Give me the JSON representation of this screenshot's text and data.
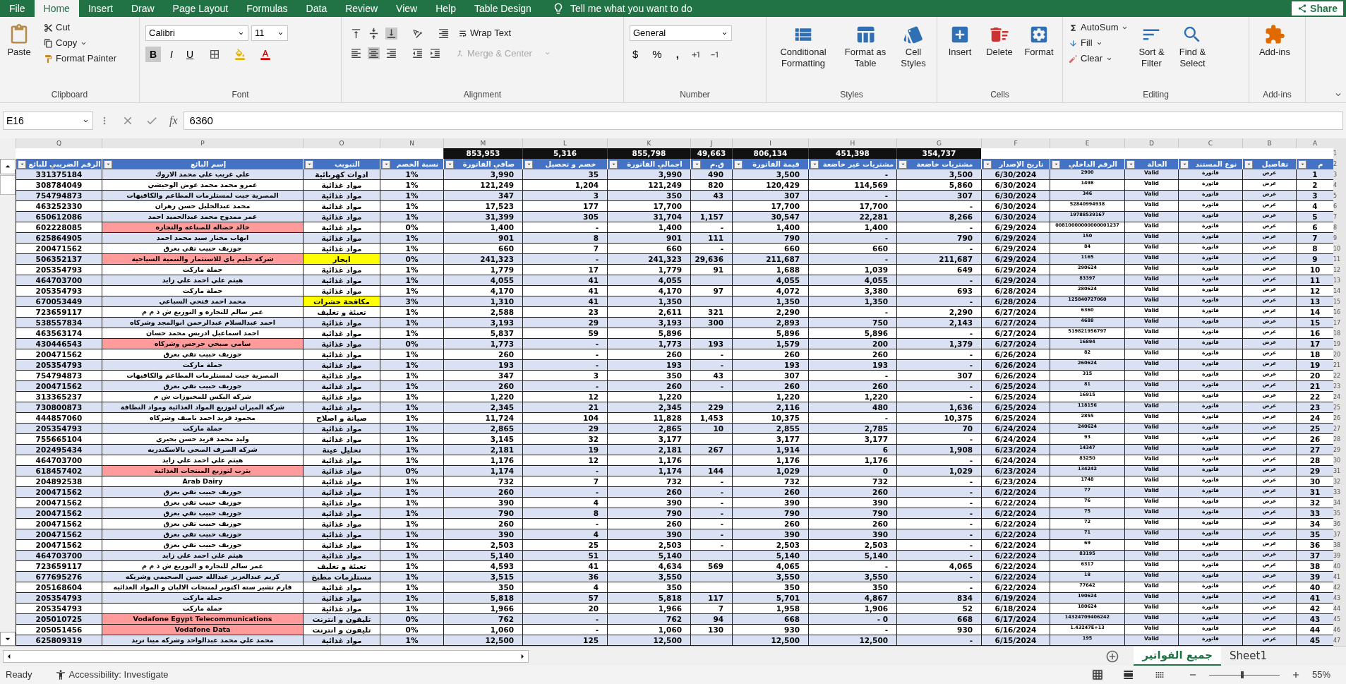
{
  "menu_tabs": {
    "file": {
      "label": "File",
      "selected": false
    },
    "home": {
      "label": "Home",
      "selected": true
    },
    "insert": {
      "label": "Insert",
      "selected": false
    },
    "draw": {
      "label": "Draw",
      "selected": false
    },
    "page_layout": {
      "label": "Page Layout",
      "selected": false
    },
    "formulas": {
      "label": "Formulas",
      "selected": false
    },
    "data": {
      "label": "Data",
      "selected": false
    },
    "review": {
      "label": "Review",
      "selected": false
    },
    "view": {
      "label": "View",
      "selected": false
    },
    "help": {
      "label": "Help",
      "selected": false
    },
    "table_design": {
      "label": "Table Design",
      "selected": false
    }
  },
  "tell_me": "Tell me what you want to do",
  "share": "Share",
  "ribbon": {
    "clipboard": {
      "label": "Clipboard",
      "paste": "Paste",
      "cut": "Cut",
      "copy": "Copy",
      "format_painter": "Format Painter"
    },
    "font": {
      "label": "Font",
      "family": "Calibri",
      "size": "11",
      "bold": "B",
      "italic": "I",
      "underline": "U"
    },
    "alignment": {
      "label": "Alignment",
      "wrap": "Wrap Text",
      "merge": "Merge & Center",
      "merge_disabled": true
    },
    "number": {
      "label": "Number",
      "format": "General",
      "currency": "$",
      "percent": "%",
      "comma": ","
    },
    "styles": {
      "label": "Styles",
      "conditional_formatting": "Conditional Formatting",
      "format_as_table": "Format as Table",
      "cell_styles": "Cell Styles"
    },
    "cells": {
      "label": "Cells",
      "insert": "Insert",
      "delete": "Delete",
      "format": "Format"
    },
    "editing": {
      "label": "Editing",
      "autosum": "AutoSum",
      "fill": "Fill",
      "clear": "Clear",
      "sort": "Sort & Filter",
      "find": "Find & Select"
    },
    "addins": {
      "label": "Add-ins",
      "button": "Add-ins"
    }
  },
  "formula_bar": {
    "name_box": "E16",
    "fx": "fx",
    "value": "6360"
  },
  "table": {
    "columns": [
      {
        "letter": "A",
        "header": "م"
      },
      {
        "letter": "B",
        "header": "تفاصيل"
      },
      {
        "letter": "C",
        "header": "نوع المستند"
      },
      {
        "letter": "D",
        "header": "الحالة"
      },
      {
        "letter": "E",
        "header": "الرقم الداخلي"
      },
      {
        "letter": "F",
        "header": "تاريخ الإصدار"
      },
      {
        "letter": "G",
        "header": "مشتريات خاضعة",
        "total": "354,737"
      },
      {
        "letter": "H",
        "header": "مشتريات غير خاضعة",
        "total": "451,398"
      },
      {
        "letter": "I",
        "header": "قيمة الفاتورة",
        "total": "806,134"
      },
      {
        "letter": "J",
        "header": "ق.م",
        "total": "49,663"
      },
      {
        "letter": "K",
        "header": "اجمالي الفاتورة",
        "total": "855,798"
      },
      {
        "letter": "L",
        "header": "خصم و تحصيل",
        "total": "5,316"
      },
      {
        "letter": "M",
        "header": "صافي الفاتورة",
        "total": "853,953"
      },
      {
        "letter": "N",
        "header": "نسبة الخصم"
      },
      {
        "letter": "O",
        "header": "التبويب"
      },
      {
        "letter": "P",
        "header": "إسم البائع"
      },
      {
        "letter": "Q",
        "header": "الرقم الضريبي للبائع"
      }
    ],
    "totals_row_header": "1",
    "header_row_header": "2",
    "rows": [
      {
        "row_header": "3",
        "cells": [
          "1",
          "عرض",
          "فاتورة",
          "Valid",
          "2900",
          "6/30/2024",
          "3,500",
          "-",
          "3,500",
          "490",
          "3,990",
          "35",
          "3,990",
          "1%",
          "ادوات كهربائية",
          "علي غريب علي محمد الاروك",
          "331375184"
        ]
      },
      {
        "row_header": "4",
        "cells": [
          "2",
          "عرض",
          "فاتورة",
          "Valid",
          "1498",
          "6/30/2024",
          "5,860",
          "114,569",
          "120,429",
          "820",
          "121,249",
          "1,204",
          "121,249",
          "1%",
          "مواد غذائية",
          "عمرو محمد محمد عوض الوحيشي",
          "308784049"
        ]
      },
      {
        "row_header": "5",
        "cells": [
          "3",
          "عرض",
          "فاتورة",
          "Valid",
          "346",
          "6/30/2024",
          "307",
          "-",
          "307",
          "43",
          "350",
          "3",
          "347",
          "1%",
          "مواد غذائية",
          "المصرية جيت لمستلزمات المطاعم والكافيهات",
          "754794873"
        ]
      },
      {
        "row_header": "6",
        "cells": [
          "4",
          "عرض",
          "فاتورة",
          "Valid",
          "52840994938",
          "6/30/2024",
          "-",
          "17,700",
          "17,700",
          null,
          "17,700",
          "177",
          "17,523",
          "1%",
          "مواد غذائية",
          "محمد عبدالجليل حسن زهران",
          "463252330"
        ]
      },
      {
        "row_header": "7",
        "cells": [
          "5",
          "عرض",
          "فاتورة",
          "Valid",
          "19788539167",
          "6/30/2024",
          "8,266",
          "22,281",
          "30,547",
          "1,157",
          "31,704",
          "305",
          "31,399",
          "1%",
          "مواد غذائية",
          "عمر ممدوح محمد عبدالحميد احمد",
          "650612086"
        ]
      },
      {
        "row_header": "8",
        "cells": [
          "6",
          "عرض",
          "فاتورة",
          "Valid",
          "00810000000000001237",
          "6/29/2024",
          "-",
          "1,400",
          "1,400",
          "-",
          "1,400",
          "-",
          "1,400",
          "0%",
          "مواد غذائية",
          {
            "text": "خالد خضاله للصناعه والتجاره",
            "color": "#ff9b9b"
          },
          "602228085"
        ]
      },
      {
        "row_header": "9",
        "cells": [
          "7",
          "عرض",
          "فاتورة",
          "Valid",
          "150",
          "6/29/2024",
          "790",
          "-",
          "790",
          "111",
          "901",
          "8",
          "901",
          "1%",
          "مواد غذائية",
          "ايهاب مختار سيد محمد احمد",
          "625864905"
        ]
      },
      {
        "row_header": "10",
        "cells": [
          "8",
          "عرض",
          "فاتورة",
          "Valid",
          "84",
          "6/29/2024",
          "-",
          "660",
          "660",
          "-",
          "660",
          "7",
          "660",
          "1%",
          "مواد غذائية",
          "جوزيف حبيب تقي بعزق",
          "200471562"
        ]
      },
      {
        "row_header": "11",
        "cells": [
          "9",
          "عرض",
          "فاتورة",
          "Valid",
          "1165",
          "6/29/2024",
          "211,687",
          "-",
          "211,687",
          "29,636",
          "241,323",
          "-",
          "241,323",
          "0%",
          {
            "text": "ايجار",
            "color": "#ffff00"
          },
          {
            "text": "شركه جليم باي للاستثمار والتنمية السياحية",
            "color": "#ff9b9b"
          },
          "506352137"
        ]
      },
      {
        "row_header": "12",
        "cells": [
          "10",
          "عرض",
          "فاتورة",
          "Valid",
          "290624",
          "6/29/2024",
          "649",
          "1,039",
          "1,688",
          "91",
          "1,779",
          "17",
          "1,779",
          "1%",
          "مواد غذائية",
          "جملة ماركت",
          "205354793"
        ]
      },
      {
        "row_header": "13",
        "cells": [
          "11",
          "عرض",
          "فاتورة",
          "Valid",
          "83397",
          "6/29/2024",
          "-",
          "4,055",
          "4,055",
          null,
          "4,055",
          "41",
          "4,055",
          "1%",
          "مواد غذائية",
          "هيثم علي احمد علي زايد",
          "464703700"
        ]
      },
      {
        "row_header": "14",
        "cells": [
          "12",
          "عرض",
          "فاتورة",
          "Valid",
          "280624",
          "6/28/2024",
          "693",
          "3,380",
          "4,072",
          "97",
          "4,170",
          "41",
          "4,170",
          "1%",
          "مواد غذائية",
          "جملة ماركت",
          "205354793"
        ]
      },
      {
        "row_header": "15",
        "cells": [
          "13",
          "عرض",
          "فاتورة",
          "Valid",
          "125840727060",
          "6/28/2024",
          "-",
          "1,350",
          "1,350",
          null,
          "1,350",
          "41",
          "1,310",
          "3%",
          {
            "text": "مكافحة حشرات",
            "color": "#ffff00"
          },
          "محمد احمد فتحي السباعي",
          "670053449"
        ]
      },
      {
        "row_header": "16",
        "cells": [
          "14",
          "عرض",
          "فاتورة",
          "Valid",
          "6360",
          "6/27/2024",
          "2,290",
          "-",
          "2,290",
          "321",
          "2,611",
          "23",
          "2,588",
          "1%",
          "تعبئة و تغليف",
          "عمر سالم للتجاره و التوزيع ش ذ م م",
          "723659117"
        ]
      },
      {
        "row_header": "17",
        "cells": [
          "15",
          "عرض",
          "فاتورة",
          "Valid",
          "4688",
          "6/27/2024",
          "2,143",
          "750",
          "2,893",
          "300",
          "3,193",
          "29",
          "3,193",
          "1%",
          "مواد غذائية",
          "احمد عبدالسلام عبدالرحمن ابوالمجد وشركاه",
          "538557834"
        ]
      },
      {
        "row_header": "18",
        "cells": [
          "16",
          "عرض",
          "فاتورة",
          "Valid",
          "519821956797",
          "6/27/2024",
          "-",
          "5,896",
          "5,896",
          null,
          "5,896",
          "59",
          "5,837",
          "1%",
          "مواد غذائية",
          "احمد اسماعيل ادريس محمد حسان",
          "463563174"
        ]
      },
      {
        "row_header": "19",
        "cells": [
          "17",
          "عرض",
          "فاتورة",
          "Valid",
          "16894",
          "6/27/2024",
          "1,379",
          "200",
          "1,579",
          "193",
          "1,773",
          "-",
          "1,773",
          "0%",
          "مواد غذائية",
          {
            "text": "سامي صبحي جرجس وشركاه",
            "color": "#ff9b9b"
          },
          "430446543"
        ]
      },
      {
        "row_header": "20",
        "cells": [
          "18",
          "عرض",
          "فاتورة",
          "Valid",
          "82",
          "6/26/2024",
          "-",
          "260",
          "260",
          "-",
          "260",
          "-",
          "260",
          "1%",
          "مواد غذائية",
          "جوزيف حبيب تقي بعزق",
          "200471562"
        ]
      },
      {
        "row_header": "21",
        "cells": [
          "19",
          "عرض",
          "فاتورة",
          "Valid",
          "260624",
          "6/26/2024",
          "-",
          "193",
          "193",
          "-",
          "193",
          "-",
          "193",
          "1%",
          "مواد غذائية",
          "جملة ماركت",
          "205354793"
        ]
      },
      {
        "row_header": "22",
        "cells": [
          "20",
          "عرض",
          "فاتورة",
          "Valid",
          "315",
          "6/26/2024",
          "307",
          "-",
          "307",
          "43",
          "350",
          "3",
          "347",
          "1%",
          "مواد غذائية",
          "المصرية جيت لمستلزمات المطاعم والكافيهات",
          "754794873"
        ]
      },
      {
        "row_header": "23",
        "cells": [
          "21",
          "عرض",
          "فاتورة",
          "Valid",
          "81",
          "6/25/2024",
          "-",
          "260",
          "260",
          "-",
          "260",
          "-",
          "260",
          "1%",
          "مواد غذائية",
          "جوزيف حبيب تقي بعزق",
          "200471562"
        ]
      },
      {
        "row_header": "24",
        "cells": [
          "22",
          "عرض",
          "فاتورة",
          "Valid",
          "16915",
          "6/25/2024",
          "-",
          "1,220",
          "1,220",
          null,
          "1,220",
          "12",
          "1,220",
          "1%",
          "مواد غذائية",
          "شركه البكس للمخبوزات ش م",
          "313365237"
        ]
      },
      {
        "row_header": "25",
        "cells": [
          "23",
          "عرض",
          "فاتورة",
          "Valid",
          "118156",
          "6/25/2024",
          "1,636",
          "480",
          "2,116",
          "229",
          "2,345",
          "21",
          "2,345",
          "1%",
          "مواد غذائية",
          "شركة الميزان لتوزيع المواد الغذائية ومواد النظافة",
          "730800873"
        ]
      },
      {
        "row_header": "26",
        "cells": [
          "24",
          "عرض",
          "فاتورة",
          "Valid",
          "2855",
          "6/25/2024",
          "10,375",
          "-",
          "10,375",
          "1,453",
          "11,828",
          "104",
          "11,724",
          "1%",
          "صيانة و اصلاح",
          "محمود فريد احمد ناصف وشركاه",
          "444857060"
        ]
      },
      {
        "row_header": "27",
        "cells": [
          "25",
          "عرض",
          "فاتورة",
          "Valid",
          "240624",
          "6/24/2024",
          "70",
          "2,785",
          "2,855",
          "10",
          "2,865",
          "29",
          "2,865",
          "1%",
          "مواد غذائية",
          "جملة ماركت",
          "205354793"
        ]
      },
      {
        "row_header": "28",
        "cells": [
          "26",
          "عرض",
          "فاتورة",
          "Valid",
          "93",
          "6/24/2024",
          "-",
          "3,177",
          "3,177",
          null,
          "3,177",
          "32",
          "3,145",
          "1%",
          "مواد غذائية",
          "وليد محمد فريد حسن بحيري",
          "755665104"
        ]
      },
      {
        "row_header": "29",
        "cells": [
          "27",
          "عرض",
          "فاتورة",
          "Valid",
          "14347",
          "6/23/2024",
          "1,908",
          "6",
          "1,914",
          "267",
          "2,181",
          "19",
          "2,181",
          "1%",
          "تحليل عينة",
          "شركه الصرف الصحي بالاسكندريه",
          "202495434"
        ]
      },
      {
        "row_header": "30",
        "cells": [
          "28",
          "عرض",
          "فاتورة",
          "Valid",
          "83250",
          "6/24/2024",
          "-",
          "1,176",
          "1,176",
          null,
          "1,176",
          "12",
          "1,176",
          "1%",
          "مواد غذائية",
          "هيثم علي احمد علي زايد",
          "464703700"
        ]
      },
      {
        "row_header": "31",
        "cells": [
          "29",
          "عرض",
          "فاتورة",
          "Valid",
          "134242",
          "6/23/2024",
          "1,029",
          "0",
          "1,029",
          "144",
          "1,174",
          "-",
          "1,174",
          "0%",
          "مواد غذائية",
          {
            "text": "يثرب لتوزيع المنتجات الغذائية",
            "color": "#ff9b9b"
          },
          "618457402"
        ]
      },
      {
        "row_header": "32",
        "cells": [
          "30",
          "عرض",
          "فاتورة",
          "Valid",
          "1748",
          "6/23/2024",
          "-",
          "732",
          "732",
          "-",
          "732",
          "7",
          "732",
          "1%",
          "مواد غذائية",
          "Arab Dairy",
          "204892538"
        ]
      },
      {
        "row_header": "33",
        "cells": [
          "31",
          "عرض",
          "فاتورة",
          "Valid",
          "77",
          "6/22/2024",
          "-",
          "260",
          "260",
          "-",
          "260",
          "-",
          "260",
          "1%",
          "مواد غذائية",
          "جوزيف حبيب تقي بعزق",
          "200471562"
        ]
      },
      {
        "row_header": "34",
        "cells": [
          "32",
          "عرض",
          "فاتورة",
          "Valid",
          "76",
          "6/22/2024",
          "-",
          "390",
          "390",
          "-",
          "390",
          "4",
          "390",
          "1%",
          "مواد غذائية",
          "جوزيف حبيب تقي بعزق",
          "200471562"
        ]
      },
      {
        "row_header": "35",
        "cells": [
          "33",
          "عرض",
          "فاتورة",
          "Valid",
          "75",
          "6/22/2024",
          "-",
          "790",
          "790",
          "-",
          "790",
          "8",
          "790",
          "1%",
          "مواد غذائية",
          "جوزيف حبيب تقي بعزق",
          "200471562"
        ]
      },
      {
        "row_header": "36",
        "cells": [
          "34",
          "عرض",
          "فاتورة",
          "Valid",
          "72",
          "6/22/2024",
          "-",
          "260",
          "260",
          "-",
          "260",
          "-",
          "260",
          "1%",
          "مواد غذائية",
          "جوزيف حبيب تقي بعزق",
          "200471562"
        ]
      },
      {
        "row_header": "37",
        "cells": [
          "35",
          "عرض",
          "فاتورة",
          "Valid",
          "71",
          "6/22/2024",
          "-",
          "390",
          "390",
          "-",
          "390",
          "4",
          "390",
          "1%",
          "مواد غذائية",
          "جوزيف حبيب تقي بعزق",
          "200471562"
        ]
      },
      {
        "row_header": "38",
        "cells": [
          "36",
          "عرض",
          "فاتورة",
          "Valid",
          "69",
          "6/22/2024",
          "-",
          "2,503",
          "2,503",
          "-",
          "2,503",
          "25",
          "2,503",
          "1%",
          "مواد غذائية",
          "جوزيف حبيب تقي بعزق",
          "200471562"
        ]
      },
      {
        "row_header": "39",
        "cells": [
          "37",
          "عرض",
          "فاتورة",
          "Valid",
          "83195",
          "6/22/2024",
          "-",
          "5,140",
          "5,140",
          null,
          "5,140",
          "51",
          "5,140",
          "1%",
          "مواد غذائية",
          "هيثم علي احمد علي زايد",
          "464703700"
        ]
      },
      {
        "row_header": "40",
        "cells": [
          "38",
          "عرض",
          "فاتورة",
          "Valid",
          "6317",
          "6/22/2024",
          "4,065",
          "-",
          "4,065",
          "569",
          "4,634",
          "41",
          "4,593",
          "1%",
          "تعبئة و تغليف",
          "عمر سالم للتجاره و التوزيع ش ذ م م",
          "723659117"
        ]
      },
      {
        "row_header": "41",
        "cells": [
          "39",
          "عرض",
          "فاتورة",
          "Valid",
          "18",
          "6/22/2024",
          "-",
          "3,550",
          "3,550",
          null,
          "3,550",
          "36",
          "3,515",
          "1%",
          "مستلزمات مطبخ",
          "كريم عبدالعزيز عبدالله حسن الصحيمي وشريكه",
          "677695276"
        ]
      },
      {
        "row_header": "42",
        "cells": [
          "40",
          "عرض",
          "فاتورة",
          "Valid",
          "77642",
          "6/22/2024",
          "-",
          "350",
          "350",
          null,
          "350",
          "4",
          "350",
          "1%",
          "مواد غذائية",
          "فارم تشيز سته اكتوبر لمنتجات الالبان و المواد الغذائيه",
          "205168604"
        ]
      },
      {
        "row_header": "43",
        "cells": [
          "41",
          "عرض",
          "فاتورة",
          "Valid",
          "190624",
          "6/19/2024",
          "834",
          "4,867",
          "5,701",
          "117",
          "5,818",
          "57",
          "5,818",
          "1%",
          "مواد غذائية",
          "جملة ماركت",
          "205354793"
        ]
      },
      {
        "row_header": "44",
        "cells": [
          "42",
          "عرض",
          "فاتورة",
          "Valid",
          "180624",
          "6/18/2024",
          "52",
          "1,906",
          "1,958",
          "7",
          "1,966",
          "20",
          "1,966",
          "1%",
          "مواد غذائية",
          "جملة ماركت",
          "205354793"
        ]
      },
      {
        "row_header": "45",
        "cells": [
          "43",
          "عرض",
          "فاتورة",
          "Valid",
          "14324709406242",
          "6/17/2024",
          "668",
          "-   0",
          "668",
          "94",
          "762",
          "-",
          "762",
          "0%",
          "تليفون و انترنت",
          {
            "text": "Vodafone Egypt Telecommunications",
            "color": "#ff9b9b"
          },
          "205010725"
        ]
      },
      {
        "row_header": "46",
        "cells": [
          "44",
          "عرض",
          "فاتورة",
          "Valid",
          "1.43247E+13",
          "6/16/2024",
          "930",
          "-",
          "930",
          "130",
          "1,060",
          "-",
          "1,060",
          "0%",
          "تليفون و انترنت",
          {
            "text": "Vodafone Data",
            "color": "#ff9b9b"
          },
          "205051456"
        ]
      },
      {
        "row_header": "47",
        "cells": [
          "45",
          "عرض",
          "فاتورة",
          "Valid",
          "195",
          "6/15/2024",
          "-",
          "12,500",
          "12,500",
          null,
          "12,500",
          "125",
          "12,500",
          "1%",
          "مواد غذائية",
          "محمد علي محمد عبدالواحد وشركه مينا تريد",
          "625809319"
        ]
      }
    ]
  },
  "sheet_tabs": [
    {
      "label": "Sheet1",
      "selected": false
    },
    {
      "label": "جميع الفواتير",
      "selected": true
    }
  ],
  "status_bar": {
    "ready": "Ready",
    "accessibility": "Accessibility: Investigate",
    "zoom": {
      "reading": "55%",
      "level": 0.45
    }
  }
}
